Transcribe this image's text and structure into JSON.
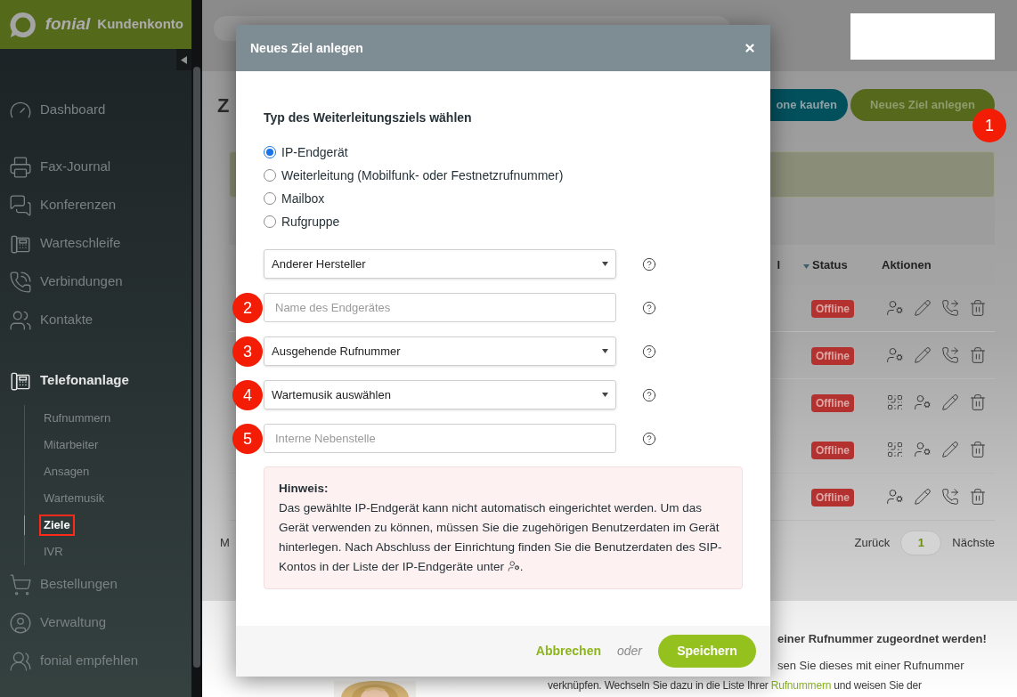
{
  "sidebar": {
    "brand": "fonial",
    "product": "Kundenkonto",
    "groups": [
      {
        "items": [
          {
            "label": "Dashboard",
            "selected": false
          }
        ]
      },
      {
        "items": [
          {
            "label": "Fax-Journal",
            "selected": false
          },
          {
            "label": "Konferenzen",
            "selected": false
          },
          {
            "label": "Warteschleife",
            "selected": false
          },
          {
            "label": "Verbindungen",
            "selected": false
          },
          {
            "label": "Kontakte",
            "selected": false
          }
        ]
      },
      {
        "items": [
          {
            "label": "Telefonanlage",
            "selected": true,
            "children": [
              {
                "label": "Rufnummern",
                "selected": false
              },
              {
                "label": "Mitarbeiter",
                "selected": false
              },
              {
                "label": "Ansagen",
                "selected": false
              },
              {
                "label": "Wartemusik",
                "selected": false
              },
              {
                "label": "Ziele",
                "selected": true
              },
              {
                "label": "IVR",
                "selected": false
              }
            ]
          },
          {
            "label": "Bestellungen",
            "selected": false
          },
          {
            "label": "Verwaltung",
            "selected": false
          },
          {
            "label": "fonial empfehlen",
            "selected": false
          }
        ]
      }
    ]
  },
  "page": {
    "heading": "Z",
    "buttons": [
      {
        "label": "one kaufen",
        "kind": "secondary"
      },
      {
        "label": "Neues Ziel anlegen",
        "kind": "primary",
        "step": "1"
      }
    ],
    "table": {
      "columns": [
        {
          "label": "l",
          "sorted": false
        },
        {
          "label": "Status",
          "sorted": true
        },
        {
          "label": "Aktionen",
          "sorted": false
        }
      ],
      "rows": [
        {
          "status": "Offline",
          "kind": "forward"
        },
        {
          "status": "Offline",
          "kind": "forward"
        },
        {
          "status": "Offline",
          "kind": "qr"
        },
        {
          "status": "Offline",
          "kind": "qr"
        },
        {
          "status": "Offline",
          "kind": "forward"
        }
      ]
    },
    "footer_letter": "M",
    "pagination": {
      "prev": "Zurück",
      "page": "1",
      "next": "Nächste"
    },
    "info": {
      "heading": "einer Rufnummer zugeordnet werden!",
      "line_1": "sen Sie dieses mit einer Rufnummer",
      "line_2": {
        "before": "verknüpfen. Wechseln Sie dazu in die Liste Ihrer ",
        "link": "Rufnummern",
        "after": " und weisen Sie der"
      }
    }
  },
  "dialog": {
    "title": "Neues Ziel anlegen",
    "prompt": "Typ des Weiterleitungsziels wählen",
    "options": [
      {
        "label": "IP-Endgerät",
        "selected": true
      },
      {
        "label": "Weiterleitung (Mobilfunk- oder Festnetzrufnummer)",
        "selected": false
      },
      {
        "label": "Mailbox",
        "selected": false
      },
      {
        "label": "Rufgruppe",
        "selected": false
      }
    ],
    "fields": [
      {
        "kind": "select",
        "value": "Anderer Hersteller"
      },
      {
        "kind": "input",
        "placeholder": "Name des Endgerätes",
        "step": "2"
      },
      {
        "kind": "select",
        "value": "Ausgehende Rufnummer",
        "step": "3"
      },
      {
        "kind": "select",
        "value": "Wartemusik auswählen",
        "step": "4"
      },
      {
        "kind": "input",
        "placeholder": "Interne Nebenstelle",
        "step": "5"
      }
    ],
    "notice": {
      "title": "Hinweis:",
      "text": "Das gewählte IP-Endgerät kann nicht automatisch eingerichtet werden. Um das Gerät verwenden zu können, müssen Sie die zugehörigen Benutzerdaten im Gerät hinterlegen. Nach Abschluss der Einrichtung finden Sie die Benutzerdaten des SIP-Kontos in der Liste der IP-Endgeräte unter",
      "after": "."
    },
    "actions": {
      "cancel": "Abbrechen",
      "or": "oder",
      "save": "Speichern"
    }
  }
}
